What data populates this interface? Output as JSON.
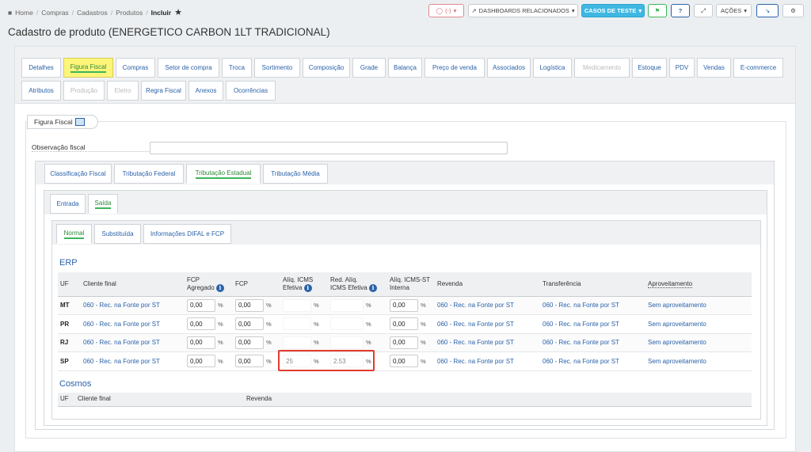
{
  "breadcrumb": {
    "items": [
      "Home",
      "Compras",
      "Cadastros",
      "Produtos"
    ],
    "current": "Incluir"
  },
  "toolbar": {
    "status_label": "(-)",
    "dashboards_label": "DASHBOARDS RELACIONADOS",
    "test_cases_label": "CASOS DE TESTE",
    "help_label": "?",
    "actions_label": "AÇÕES"
  },
  "page_title": "Cadastro de produto (ENERGETICO CARBON 1LT TRADICIONAL)",
  "main_tabs_row1": [
    "Detalhes",
    "Figura Fiscal",
    "Compras",
    "Setor de compra",
    "Troca",
    "Sortimento",
    "Composição",
    "Grade",
    "Balança",
    "Preço de venda",
    "Associados",
    "Logística",
    "Medicamento",
    "Estoque",
    "PDV",
    "Vendas",
    "E-commerce"
  ],
  "main_tabs_row2": [
    "Atributos",
    "Produção",
    "Eletro",
    "Regra Fiscal",
    "Anexos",
    "Ocorrências"
  ],
  "figura_fiscal": {
    "legend": "Figura Fiscal",
    "obs_label": "Observação fiscal",
    "obs_value": ""
  },
  "tabs_level1": [
    "Classificação Fiscal",
    "Tributação Federal",
    "Tributação Estadual",
    "Tributação Média"
  ],
  "tabs_level2": [
    "Entrada",
    "Saída"
  ],
  "tabs_level3": [
    "Normal",
    "Substituída",
    "Informações DIFAL e FCP"
  ],
  "erp": {
    "title": "ERP",
    "headers": {
      "uf": "UF",
      "cliente_final": "Cliente final",
      "fcp_agregado_1": "FCP",
      "fcp_agregado_2": "Agregado",
      "fcp": "FCP",
      "aliq_icms_1": "Alíq. ICMS",
      "aliq_icms_2": "Efetiva",
      "red_aliq_1": "Red. Alíq.",
      "red_aliq_2": "ICMS Efetiva",
      "aliq_st_1": "Alíq. ICMS-ST",
      "aliq_st_2": "Interna",
      "revenda": "Revenda",
      "transferencia": "Transferência",
      "aproveitamento": "Aproveitamento"
    },
    "pct": "%",
    "info_glyph": "i",
    "rows": [
      {
        "uf": "MT",
        "cliente_final": "060 - Rec. na Fonte por ST",
        "fcp_agregado": "0,00",
        "fcp": "0,00",
        "aliq_icms": "",
        "red_aliq": "",
        "aliq_st": "0,00",
        "revenda": "060 - Rec. na Fonte por ST",
        "transferencia": "060 - Rec. na Fonte por ST",
        "aproveitamento": "Sem aproveitamento"
      },
      {
        "uf": "PR",
        "cliente_final": "060 - Rec. na Fonte por ST",
        "fcp_agregado": "0,00",
        "fcp": "0,00",
        "aliq_icms": "",
        "red_aliq": "",
        "aliq_st": "0,00",
        "revenda": "060 - Rec. na Fonte por ST",
        "transferencia": "060 - Rec. na Fonte por ST",
        "aproveitamento": "Sem aproveitamento"
      },
      {
        "uf": "RJ",
        "cliente_final": "060 - Rec. na Fonte por ST",
        "fcp_agregado": "0,00",
        "fcp": "0,00",
        "aliq_icms": "",
        "red_aliq": "",
        "aliq_st": "0,00",
        "revenda": "060 - Rec. na Fonte por ST",
        "transferencia": "060 - Rec. na Fonte por ST",
        "aproveitamento": "Sem aproveitamento"
      },
      {
        "uf": "SP",
        "cliente_final": "060 - Rec. na Fonte por ST",
        "fcp_agregado": "0,00",
        "fcp": "0,00",
        "aliq_icms": "25",
        "red_aliq": "2.53",
        "aliq_st": "0,00",
        "revenda": "060 - Rec. na Fonte por ST",
        "transferencia": "060 - Rec. na Fonte por ST",
        "aproveitamento": "Sem aproveitamento"
      }
    ]
  },
  "cosmos": {
    "title": "Cosmos",
    "headers": {
      "uf": "UF",
      "cliente_final": "Cliente final",
      "revenda": "Revenda"
    }
  },
  "colors": {
    "accent": "#2a62a8",
    "active_tab": "#fff57a",
    "highlight": "#e33b2e",
    "teal": "#3eb7e3"
  }
}
